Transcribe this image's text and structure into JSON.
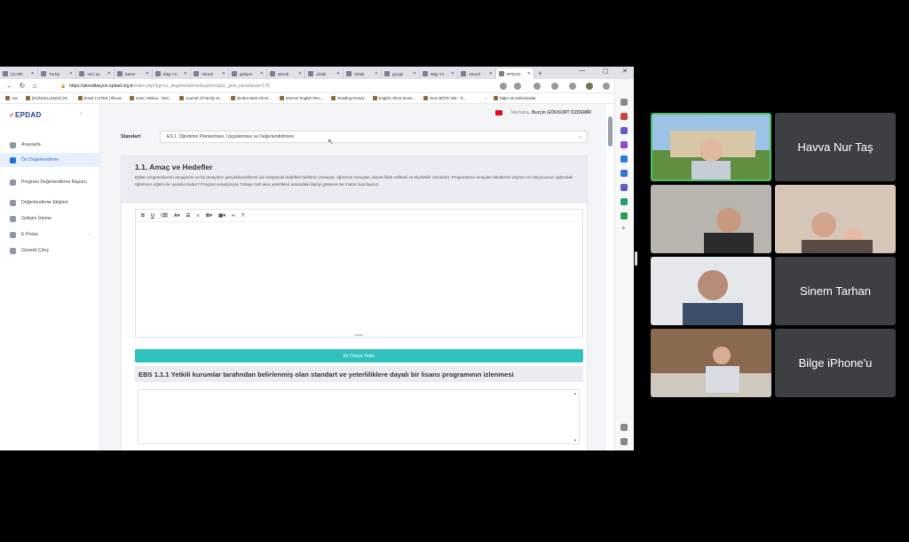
{
  "browser": {
    "tabs": [
      {
        "label": "(3) Wh"
      },
      {
        "label": "Türkiy"
      },
      {
        "label": "Yeni se"
      },
      {
        "label": "bartın"
      },
      {
        "label": "Bilgi Yö"
      },
      {
        "label": "Akredi"
      },
      {
        "label": "gelişen"
      },
      {
        "label": "akredi"
      },
      {
        "label": "cikitdı"
      },
      {
        "label": "cikitdı"
      },
      {
        "label": "googlı"
      },
      {
        "label": "Bilgi Yö"
      },
      {
        "label": "Akredi"
      },
      {
        "label": "EPDAD"
      }
    ],
    "url_host": "https://akreditasyon.epdad.org.tr",
    "url_path": "/index.php?pg=oz_degerlendirme&sayfa=rapor_giris_ekrani&val=179",
    "bookmarks": [
      "Ara",
      "(GÜNCELLENDİ) 20...",
      "Email | CITES | Illinois",
      "Kose, Melina - Outl...",
      "Journal of Family Hi...",
      "Zimbra Web Client...",
      "Internet English Res...",
      "Reading History",
      "English Short Storie...",
      "Ders BÖTE 205 - Ö..."
    ],
    "other_bookmarks": "Diğer sık kullanılanlar"
  },
  "app": {
    "logo": "EPDAD",
    "menu": [
      {
        "label": "Anasayfa"
      },
      {
        "label": "Öz Değerlendirme"
      },
      {
        "label": "Program Değerlendirme Raporu"
      },
      {
        "label": "Değerlendirme Ekipleri"
      },
      {
        "label": "Gelişim İzleme"
      },
      {
        "label": "E-Posta"
      },
      {
        "label": "Güvenli Çıkış"
      }
    ],
    "greeting": "Merhaba,",
    "user_name": "Burçin GÖKKURT ÖZDEMİR",
    "standart_label": "Standart",
    "standart_value": "ES 1. Öğretimin Planlanması, Uygulanması ve Değerlendirilmesi",
    "section_title": "1.1. Amaç ve Hedefler",
    "section_desc": "Eğitim programlarının amaçlarını ve bu amaçların gerçekleşebilmesi için ulaşılacak hedefleri belirtiniz (Amaçlar, öğrenme sonuçları olarak ifade edilmeli ve ölçülebilir olmalıdır). Programların amaçları fakültenin vizyonu ve misyonunun ışığındaki öğretmen eğitimi ile uyumlu mudur? Program amaçlarıyla Türkiye özel alan yeterlikleri arasındaki ilişkiyi gösteren bir matris hazırlayınız.",
    "upload_label": "Ek Dosya Yükle",
    "ebs_title": "EBS 1.1.1 Yetkili kurumlar tarafından belirlenmiş olan standart ve yeterliliklere dayalı bir lisans programının izlenmesi"
  },
  "participants": [
    {
      "name": "Havva Nur Taş"
    },
    {
      "name": "Sinem Tarhan"
    },
    {
      "name": "Bilge iPhone'u"
    }
  ],
  "colors": {
    "accent": "#2fc1bd",
    "active_speaker": "#4fc065",
    "tile_bg": "#3c4043"
  }
}
